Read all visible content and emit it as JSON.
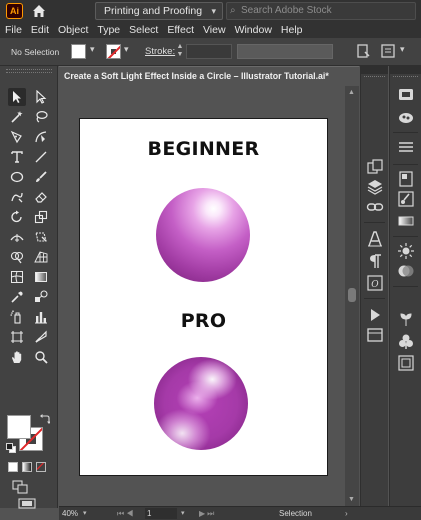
{
  "app": {
    "logo_text": "Ai",
    "workspace": "Printing and Proofing",
    "search_placeholder": "Search Adobe Stock"
  },
  "menu": [
    "File",
    "Edit",
    "Object",
    "Type",
    "Select",
    "Effect",
    "View",
    "Window",
    "Help"
  ],
  "control_bar": {
    "selection_text": "No Selection",
    "stroke_label": "Stroke:"
  },
  "document": {
    "tab_title": "Create a Soft Light Effect Inside a Circle – Illustrator Tutorial.ai*"
  },
  "artboard": {
    "heading_top": "BEGINNER",
    "heading_bottom": "PRO"
  },
  "colors": {
    "accent_logo": "#ff9a00",
    "sphere_purple": "#a53aa8",
    "stroke_none_red": "#e0282a"
  },
  "status_bar": {
    "zoom": "40%",
    "page": "1",
    "status": "Selection"
  }
}
